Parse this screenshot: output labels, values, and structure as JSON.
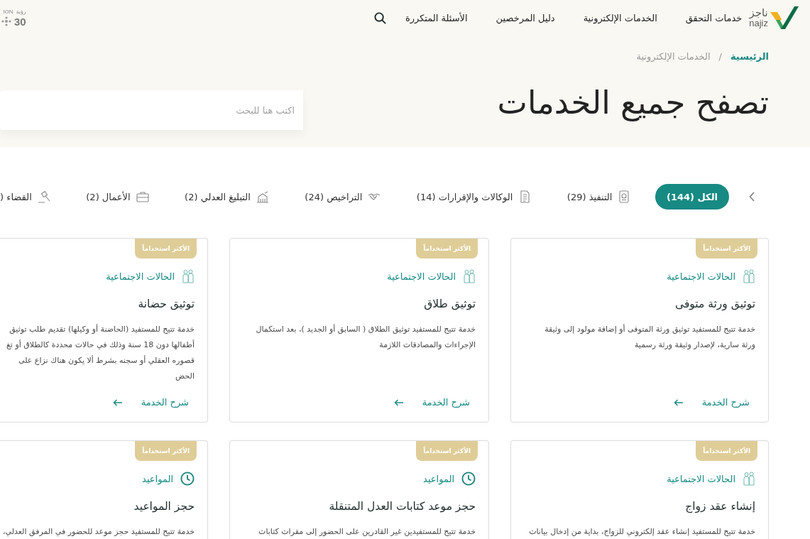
{
  "header": {
    "logo": {
      "arabic": "ناجز",
      "latin": "najiz"
    },
    "nav": [
      "خدمات التحقق",
      "الخدمات الإلكترونية",
      "دليل المرخصين",
      "الأسئلة المتكررة"
    ],
    "partner_logo": {
      "arabic": "رؤية",
      "latin": "ION",
      "number": "30"
    }
  },
  "breadcrumb": {
    "items": [
      {
        "label": "الرئيسية",
        "current": false
      },
      {
        "label": "الخدمات الإلكترونية",
        "current": true
      }
    ],
    "separator": "/"
  },
  "page_title": "تصفح جميع الخدمات",
  "search": {
    "placeholder": "اكتب هنا للبحث"
  },
  "tabs": [
    {
      "label": "الكل (144)",
      "kind": "all",
      "selected": true
    },
    {
      "label": "التنفيذ (29)",
      "kind": "execution",
      "selected": false
    },
    {
      "label": "الوكالات والإقرارات (14)",
      "kind": "power",
      "selected": false
    },
    {
      "label": "التراخيص (24)",
      "kind": "license",
      "selected": false
    },
    {
      "label": "التبليغ العدلي (2)",
      "kind": "notice",
      "selected": false
    },
    {
      "label": "الأعمال (2)",
      "kind": "business",
      "selected": false
    },
    {
      "label": "القضاء (",
      "kind": "judiciary",
      "selected": false
    }
  ],
  "cards": [
    {
      "badge": "الأكثر استخداماً",
      "category": {
        "label": "الحالات الاجتماعية",
        "kind": "social"
      },
      "title": "توثيق ورثة متوفى",
      "description_lines": [
        "خدمة تتيح للمستفيد توثيق ورثة المتوفى أو إضافة مولود إلى وثيقة",
        "ورثة سارية، لإصدار وثيقة ورثة رسمية"
      ],
      "link": "شرح الخدمة"
    },
    {
      "badge": "الأكثر استخداماً",
      "category": {
        "label": "الحالات الاجتماعية",
        "kind": "social"
      },
      "title": "توثيق طلاق",
      "description_lines": [
        "خدمة تتيح للمستفيد توثيق الطلاق ( السابق أو الجديد )، بعد استكمال",
        "الإجراءات والمصادقات اللازمة"
      ],
      "link": "شرح الخدمة"
    },
    {
      "badge": "الأكثر استخداماً",
      "category": {
        "label": "الحالات الاجتماعية",
        "kind": "social"
      },
      "title": "توثيق حضانة",
      "description_lines": [
        "خدمة تتيح للمستفيد (الحاضنة أو وكيلها) تقديم طلب توثيق",
        "أطفالها دون 18 سنة وذلك في حالات محددة كالطلاق أو تغ",
        "قصوره العقلي أو سجنه بشرط ألا يكون هناك نزاع على الحض"
      ],
      "link": "شرح الخدمة"
    },
    {
      "badge": "الأكثر استخداماً",
      "category": {
        "label": "الحالات الاجتماعية",
        "kind": "social"
      },
      "title": "إنشاء عقد زواج",
      "description_lines": [
        "خدمة تتيح للمستفيد إنشاء عقد إلكتروني للزواج، بداية من إدخال بيانات"
      ]
    },
    {
      "badge": "الأكثر استخداماً",
      "category": {
        "label": "المواعيد",
        "kind": "appointments"
      },
      "title": "حجز موعد كتابات العدل المتنقلة",
      "description_lines": [
        "خدمة تتيح للمستفيدين غير القادرين على الحضور إلى مقرات كتابات"
      ]
    },
    {
      "badge": "الأكثر استخداماً",
      "category": {
        "label": "المواعيد",
        "kind": "appointments"
      },
      "title": "حجز المواعيد",
      "description_lines": [
        "خدمة تتيح للمستفيد حجز موعد للحضور في المرفق العدلي،"
      ]
    }
  ]
}
